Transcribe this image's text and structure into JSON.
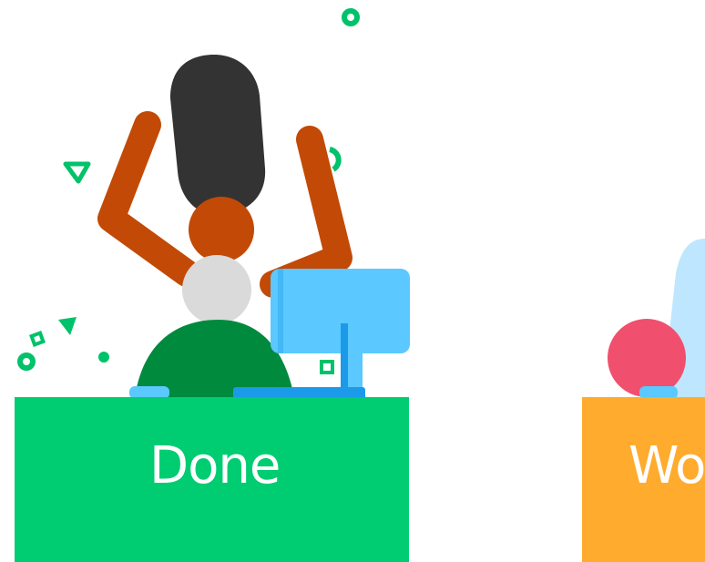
{
  "desks": [
    {
      "label": "Done",
      "color": "#00cc72"
    },
    {
      "label": "Wo",
      "color": "#ffab2e"
    }
  ],
  "colors": {
    "skin": "#c24a06",
    "hair": "#333333",
    "collar": "#dadada",
    "shirt": "#008a3e",
    "monitor": "#5bc8ff",
    "monitor_stand": "#1a9ae8",
    "confetti": "#00c26a",
    "pink_head": "#f0506e",
    "light_blue_shape": "#bfe6ff"
  }
}
